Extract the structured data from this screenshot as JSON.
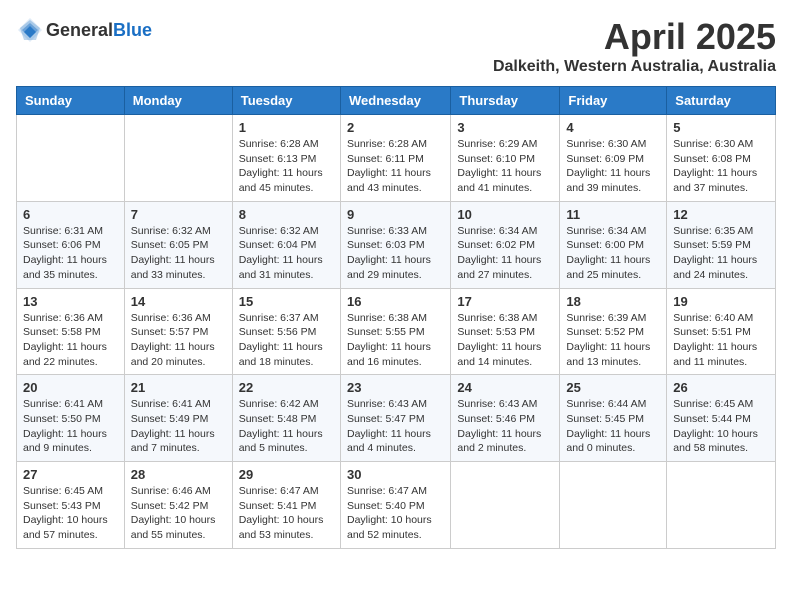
{
  "header": {
    "logo_general": "General",
    "logo_blue": "Blue",
    "title": "April 2025",
    "location": "Dalkeith, Western Australia, Australia"
  },
  "calendar": {
    "days_of_week": [
      "Sunday",
      "Monday",
      "Tuesday",
      "Wednesday",
      "Thursday",
      "Friday",
      "Saturday"
    ],
    "weeks": [
      [
        {
          "day": "",
          "sunrise": "",
          "sunset": "",
          "daylight": ""
        },
        {
          "day": "",
          "sunrise": "",
          "sunset": "",
          "daylight": ""
        },
        {
          "day": "1",
          "sunrise": "Sunrise: 6:28 AM",
          "sunset": "Sunset: 6:13 PM",
          "daylight": "Daylight: 11 hours and 45 minutes."
        },
        {
          "day": "2",
          "sunrise": "Sunrise: 6:28 AM",
          "sunset": "Sunset: 6:11 PM",
          "daylight": "Daylight: 11 hours and 43 minutes."
        },
        {
          "day": "3",
          "sunrise": "Sunrise: 6:29 AM",
          "sunset": "Sunset: 6:10 PM",
          "daylight": "Daylight: 11 hours and 41 minutes."
        },
        {
          "day": "4",
          "sunrise": "Sunrise: 6:30 AM",
          "sunset": "Sunset: 6:09 PM",
          "daylight": "Daylight: 11 hours and 39 minutes."
        },
        {
          "day": "5",
          "sunrise": "Sunrise: 6:30 AM",
          "sunset": "Sunset: 6:08 PM",
          "daylight": "Daylight: 11 hours and 37 minutes."
        }
      ],
      [
        {
          "day": "6",
          "sunrise": "Sunrise: 6:31 AM",
          "sunset": "Sunset: 6:06 PM",
          "daylight": "Daylight: 11 hours and 35 minutes."
        },
        {
          "day": "7",
          "sunrise": "Sunrise: 6:32 AM",
          "sunset": "Sunset: 6:05 PM",
          "daylight": "Daylight: 11 hours and 33 minutes."
        },
        {
          "day": "8",
          "sunrise": "Sunrise: 6:32 AM",
          "sunset": "Sunset: 6:04 PM",
          "daylight": "Daylight: 11 hours and 31 minutes."
        },
        {
          "day": "9",
          "sunrise": "Sunrise: 6:33 AM",
          "sunset": "Sunset: 6:03 PM",
          "daylight": "Daylight: 11 hours and 29 minutes."
        },
        {
          "day": "10",
          "sunrise": "Sunrise: 6:34 AM",
          "sunset": "Sunset: 6:02 PM",
          "daylight": "Daylight: 11 hours and 27 minutes."
        },
        {
          "day": "11",
          "sunrise": "Sunrise: 6:34 AM",
          "sunset": "Sunset: 6:00 PM",
          "daylight": "Daylight: 11 hours and 25 minutes."
        },
        {
          "day": "12",
          "sunrise": "Sunrise: 6:35 AM",
          "sunset": "Sunset: 5:59 PM",
          "daylight": "Daylight: 11 hours and 24 minutes."
        }
      ],
      [
        {
          "day": "13",
          "sunrise": "Sunrise: 6:36 AM",
          "sunset": "Sunset: 5:58 PM",
          "daylight": "Daylight: 11 hours and 22 minutes."
        },
        {
          "day": "14",
          "sunrise": "Sunrise: 6:36 AM",
          "sunset": "Sunset: 5:57 PM",
          "daylight": "Daylight: 11 hours and 20 minutes."
        },
        {
          "day": "15",
          "sunrise": "Sunrise: 6:37 AM",
          "sunset": "Sunset: 5:56 PM",
          "daylight": "Daylight: 11 hours and 18 minutes."
        },
        {
          "day": "16",
          "sunrise": "Sunrise: 6:38 AM",
          "sunset": "Sunset: 5:55 PM",
          "daylight": "Daylight: 11 hours and 16 minutes."
        },
        {
          "day": "17",
          "sunrise": "Sunrise: 6:38 AM",
          "sunset": "Sunset: 5:53 PM",
          "daylight": "Daylight: 11 hours and 14 minutes."
        },
        {
          "day": "18",
          "sunrise": "Sunrise: 6:39 AM",
          "sunset": "Sunset: 5:52 PM",
          "daylight": "Daylight: 11 hours and 13 minutes."
        },
        {
          "day": "19",
          "sunrise": "Sunrise: 6:40 AM",
          "sunset": "Sunset: 5:51 PM",
          "daylight": "Daylight: 11 hours and 11 minutes."
        }
      ],
      [
        {
          "day": "20",
          "sunrise": "Sunrise: 6:41 AM",
          "sunset": "Sunset: 5:50 PM",
          "daylight": "Daylight: 11 hours and 9 minutes."
        },
        {
          "day": "21",
          "sunrise": "Sunrise: 6:41 AM",
          "sunset": "Sunset: 5:49 PM",
          "daylight": "Daylight: 11 hours and 7 minutes."
        },
        {
          "day": "22",
          "sunrise": "Sunrise: 6:42 AM",
          "sunset": "Sunset: 5:48 PM",
          "daylight": "Daylight: 11 hours and 5 minutes."
        },
        {
          "day": "23",
          "sunrise": "Sunrise: 6:43 AM",
          "sunset": "Sunset: 5:47 PM",
          "daylight": "Daylight: 11 hours and 4 minutes."
        },
        {
          "day": "24",
          "sunrise": "Sunrise: 6:43 AM",
          "sunset": "Sunset: 5:46 PM",
          "daylight": "Daylight: 11 hours and 2 minutes."
        },
        {
          "day": "25",
          "sunrise": "Sunrise: 6:44 AM",
          "sunset": "Sunset: 5:45 PM",
          "daylight": "Daylight: 11 hours and 0 minutes."
        },
        {
          "day": "26",
          "sunrise": "Sunrise: 6:45 AM",
          "sunset": "Sunset: 5:44 PM",
          "daylight": "Daylight: 10 hours and 58 minutes."
        }
      ],
      [
        {
          "day": "27",
          "sunrise": "Sunrise: 6:45 AM",
          "sunset": "Sunset: 5:43 PM",
          "daylight": "Daylight: 10 hours and 57 minutes."
        },
        {
          "day": "28",
          "sunrise": "Sunrise: 6:46 AM",
          "sunset": "Sunset: 5:42 PM",
          "daylight": "Daylight: 10 hours and 55 minutes."
        },
        {
          "day": "29",
          "sunrise": "Sunrise: 6:47 AM",
          "sunset": "Sunset: 5:41 PM",
          "daylight": "Daylight: 10 hours and 53 minutes."
        },
        {
          "day": "30",
          "sunrise": "Sunrise: 6:47 AM",
          "sunset": "Sunset: 5:40 PM",
          "daylight": "Daylight: 10 hours and 52 minutes."
        },
        {
          "day": "",
          "sunrise": "",
          "sunset": "",
          "daylight": ""
        },
        {
          "day": "",
          "sunrise": "",
          "sunset": "",
          "daylight": ""
        },
        {
          "day": "",
          "sunrise": "",
          "sunset": "",
          "daylight": ""
        }
      ]
    ]
  }
}
